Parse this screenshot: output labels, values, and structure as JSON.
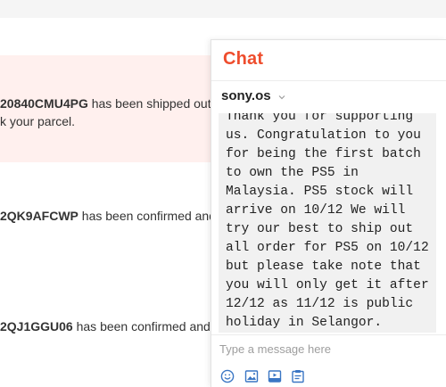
{
  "notifications": [
    {
      "order_id": "20840CMU4PG",
      "text": " has been shipped out",
      "line2": "k your parcel."
    },
    {
      "order_id": "2QK9AFCWP",
      "text": " has been confirmed and"
    },
    {
      "order_id": "2QJ1GGU06",
      "text": " has been confirmed and"
    }
  ],
  "chat": {
    "title": "Chat",
    "contact": "sony.os",
    "message_lines": [
      "Thank you for supporting",
      "us. Congratulation to you",
      "for being the first batch",
      "to own the PS5 in",
      "Malaysia. PS5 stock will",
      "arrive on 10/12 We will",
      "try our best to ship out",
      "all order for PS5 on 10/12",
      "but please take note that",
      "you will only get it after",
      "12/12 as 11/12 is public",
      "holiday in Selangor."
    ],
    "composer_placeholder": "Type a message here",
    "tools": [
      "emoji-icon",
      "image-icon",
      "video-icon",
      "order-icon"
    ]
  },
  "colors": {
    "brand": "#ee4d2d",
    "highlight_bg": "#fff0ee",
    "bubble_bg": "#f1f1f1",
    "tool_icon": "#3a76c4"
  }
}
